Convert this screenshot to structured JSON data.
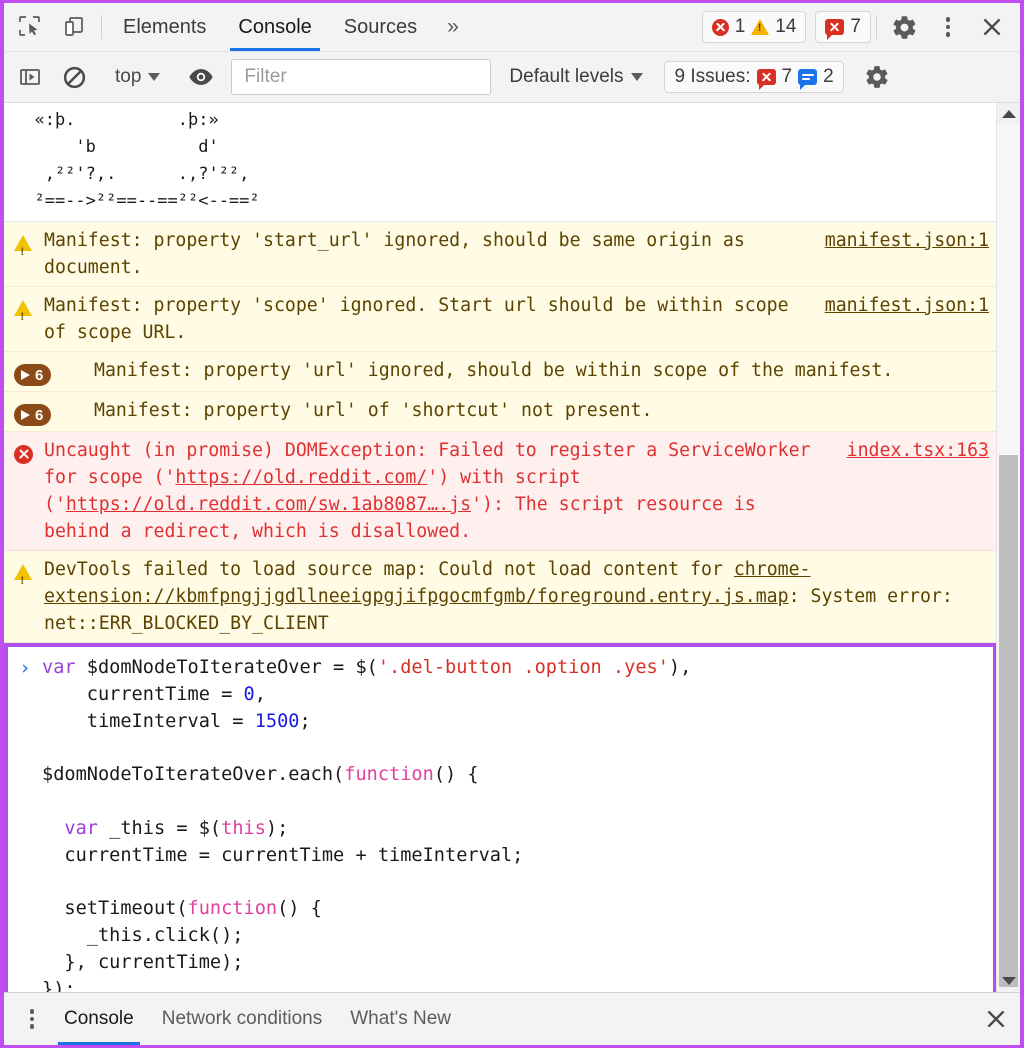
{
  "window": {
    "tabs": [
      {
        "label": "Elements",
        "selected": false
      },
      {
        "label": "Console",
        "selected": true
      },
      {
        "label": "Sources",
        "selected": false
      }
    ],
    "more_tabs_glyph": "»",
    "error_count": "1",
    "warning_count": "14",
    "issue_count": "7"
  },
  "console_toolbar": {
    "context_label": "top",
    "filter_placeholder": "Filter",
    "filter_value": "",
    "levels_label": "Default levels",
    "issues_label": "9 Issues:",
    "issues_error_count": "7",
    "issues_info_count": "2"
  },
  "messages": [
    {
      "type": "ascii-art",
      "text": "  «:þ.          .þ:»\n      'b          d'\n   ,²²'?,.      .,?'²²,\n  ²==-->²²==--==²²<--==²"
    },
    {
      "type": "warning",
      "icon": "warning-triangle-icon",
      "text": "Manifest: property 'start_url' ignored, should be same origin as document.",
      "source": "manifest.json:1"
    },
    {
      "type": "warning",
      "icon": "warning-triangle-icon",
      "text": "Manifest: property 'scope' ignored. Start url should be within scope of scope URL.",
      "source": "manifest.json:1"
    },
    {
      "type": "group",
      "icon": "group-expand-icon",
      "count": "6",
      "text": "Manifest: property 'url' ignored, should be within scope of the manifest.",
      "source": ""
    },
    {
      "type": "group",
      "icon": "group-expand-icon",
      "count": "6",
      "text": "Manifest: property 'url' of 'shortcut' not present.",
      "source": ""
    },
    {
      "type": "error",
      "icon": "error-circle-icon",
      "segments": [
        {
          "text": "Uncaught (in promise) DOMException: Failed to register a ServiceWorker for scope ('",
          "link": false
        },
        {
          "text": "https://old.reddit.com/",
          "link": true
        },
        {
          "text": "') with script ('",
          "link": false
        },
        {
          "text": "https://old.reddit.com/sw.1ab8087….js",
          "link": true
        },
        {
          "text": "'): The script resource is behind a redirect, which is disallowed.",
          "link": false
        }
      ],
      "source": "index.tsx:163"
    },
    {
      "type": "warning",
      "icon": "warning-triangle-icon",
      "segments": [
        {
          "text": "DevTools failed to load source map: Could not load content for ",
          "link": false
        },
        {
          "text": "chrome-extension://kbmfpngjjgdllneeigpgjifpgocmfgmb/foreground.entry.js.map",
          "link": true
        },
        {
          "text": ": System error: net::ERR_BLOCKED_BY_CLIENT",
          "link": false
        }
      ],
      "source": ""
    }
  ],
  "prompt": {
    "arrow": "›",
    "lines": [
      [
        {
          "t": "var ",
          "c": "kw"
        },
        {
          "t": "$domNodeToIterateOver = $(",
          "c": "plain"
        },
        {
          "t": "'.del-button .option .yes'",
          "c": "str"
        },
        {
          "t": "),",
          "c": "plain"
        }
      ],
      [
        {
          "t": "    currentTime = ",
          "c": "plain"
        },
        {
          "t": "0",
          "c": "num"
        },
        {
          "t": ",",
          "c": "plain"
        }
      ],
      [
        {
          "t": "    timeInterval = ",
          "c": "plain"
        },
        {
          "t": "1500",
          "c": "num"
        },
        {
          "t": ";",
          "c": "plain"
        }
      ],
      [
        {
          "t": "",
          "c": "plain"
        }
      ],
      [
        {
          "t": "$domNodeToIterateOver.each(",
          "c": "plain"
        },
        {
          "t": "function",
          "c": "fn"
        },
        {
          "t": "() {",
          "c": "plain"
        }
      ],
      [
        {
          "t": "",
          "c": "plain"
        }
      ],
      [
        {
          "t": "  var ",
          "c": "kw"
        },
        {
          "t": "_this = $(",
          "c": "plain"
        },
        {
          "t": "this",
          "c": "fn"
        },
        {
          "t": ");",
          "c": "plain"
        }
      ],
      [
        {
          "t": "  currentTime = currentTime + timeInterval;",
          "c": "plain"
        }
      ],
      [
        {
          "t": "",
          "c": "plain"
        }
      ],
      [
        {
          "t": "  setTimeout(",
          "c": "plain"
        },
        {
          "t": "function",
          "c": "fn"
        },
        {
          "t": "() {",
          "c": "plain"
        }
      ],
      [
        {
          "t": "    _this.click();",
          "c": "plain"
        }
      ],
      [
        {
          "t": "  }, currentTime);",
          "c": "plain"
        }
      ],
      [
        {
          "t": "});",
          "c": "plain"
        }
      ]
    ]
  },
  "drawer": {
    "tabs": [
      {
        "label": "Console",
        "selected": true
      },
      {
        "label": "Network conditions",
        "selected": false
      },
      {
        "label": "What's New",
        "selected": false
      }
    ]
  },
  "colors": {
    "accent_blue": "#1a73e8",
    "error_red": "#d93025",
    "warning_yellow": "#f4b400",
    "highlight_purple": "#b14ef0",
    "group_brown": "#8c4a17"
  }
}
